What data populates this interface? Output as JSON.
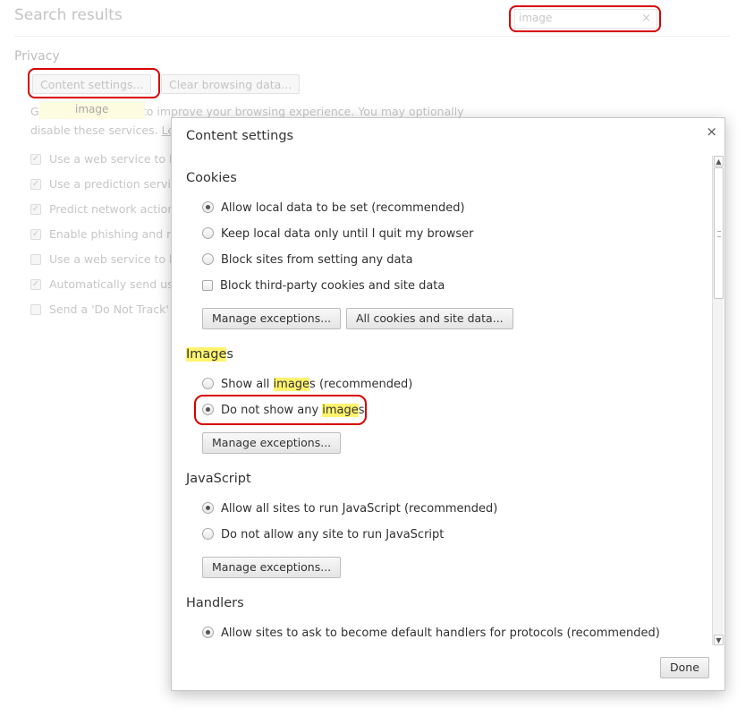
{
  "background": {
    "title": "Search results",
    "search": {
      "value": "image",
      "clear_icon": "×"
    },
    "section": "Privacy",
    "buttons": {
      "content_settings": "Content settings...",
      "clear_browsing": "Clear browsing data..."
    },
    "bubble": "image",
    "paragraph_line1": "G                            use web services to improve your browsing experience. You may optionally",
    "paragraph_line2_prefix": "disable these services.",
    "paragraph_link": "Le",
    "checks": [
      {
        "label": "Use a web service to h",
        "checked": true
      },
      {
        "label": "Use a prediction servi",
        "checked": true
      },
      {
        "label": "Predict network action",
        "checked": true
      },
      {
        "label": "Enable phishing and m",
        "checked": true
      },
      {
        "label": "Use a web service to h",
        "checked": false
      },
      {
        "label": "Automatically send us",
        "checked": true
      },
      {
        "label": "Send a 'Do Not Track'",
        "checked": false
      }
    ]
  },
  "dialog": {
    "title": "Content settings",
    "close_icon": "×",
    "cookies": {
      "heading": "Cookies",
      "options": [
        {
          "label": "Allow local data to be set (recommended)",
          "selected": true
        },
        {
          "label": "Keep local data only until I quit my browser",
          "selected": false
        },
        {
          "label": "Block sites from setting any data",
          "selected": false
        }
      ],
      "checkbox": "Block third-party cookies and site data",
      "manage": "Manage exceptions...",
      "all_cookies": "All cookies and site data..."
    },
    "images": {
      "heading_hl": "Image",
      "heading_rest": "s",
      "opt1_pre": "Show all ",
      "opt1_hl": "image",
      "opt1_post": "s (recommended)",
      "opt2_pre": "Do not show any ",
      "opt2_hl": "image",
      "opt2_post": "s",
      "selected": "do-not-show",
      "manage": "Manage exceptions..."
    },
    "javascript": {
      "heading": "JavaScript",
      "options": [
        {
          "label": "Allow all sites to run JavaScript (recommended)",
          "selected": true
        },
        {
          "label": "Do not allow any site to run JavaScript",
          "selected": false
        }
      ],
      "manage": "Manage exceptions..."
    },
    "handlers": {
      "heading": "Handlers",
      "option": "Allow sites to ask to become default handlers for protocols (recommended)"
    },
    "done": "Done"
  },
  "colors": {
    "highlight": "#fff36e",
    "annotation_ring": "#d60000"
  }
}
